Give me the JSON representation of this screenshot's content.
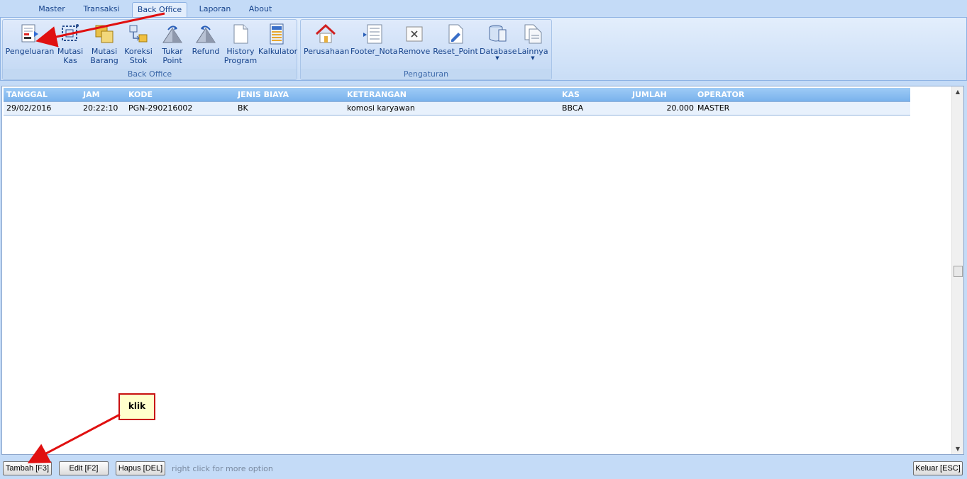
{
  "ribbon": {
    "tabs": [
      "Master",
      "Transaksi",
      "Back Office",
      "Laporan",
      "About"
    ],
    "active_tab": "Back Office",
    "groups": {
      "back_office": {
        "label": "Back Office",
        "buttons": [
          "Pengeluaran",
          "Mutasi\nKas",
          "Mutasi\nBarang",
          "Koreksi\nStok",
          "Tukar\nPoint",
          "Refund",
          "History\nProgram",
          "Kalkulator"
        ]
      },
      "pengaturan": {
        "label": "Pengaturan",
        "buttons": [
          "Perusahaan",
          "Footer_Nota",
          "Remove",
          "Reset_Point",
          "Database",
          "Lainnya"
        ]
      }
    }
  },
  "grid": {
    "columns": [
      "TANGGAL",
      "JAM",
      "KODE",
      "JENIS BIAYA",
      "KETERANGAN",
      "KAS",
      "JUMLAH",
      "OPERATOR"
    ],
    "rows": [
      [
        "29/02/2016",
        "20:22:10",
        "PGN-290216002",
        "BK",
        "komosi karyawan",
        "BBCA",
        "20.000",
        "MASTER"
      ]
    ]
  },
  "footer": {
    "tambah_label": "Tambah [F3]",
    "edit_label": "Edit [F2]",
    "hapus_label": "Hapus [DEL]",
    "hint": "right click for more option",
    "keluar_label": "Keluar [ESC]"
  },
  "annotation": {
    "callout_text": "klik",
    "arrow_color": "#e01010"
  }
}
